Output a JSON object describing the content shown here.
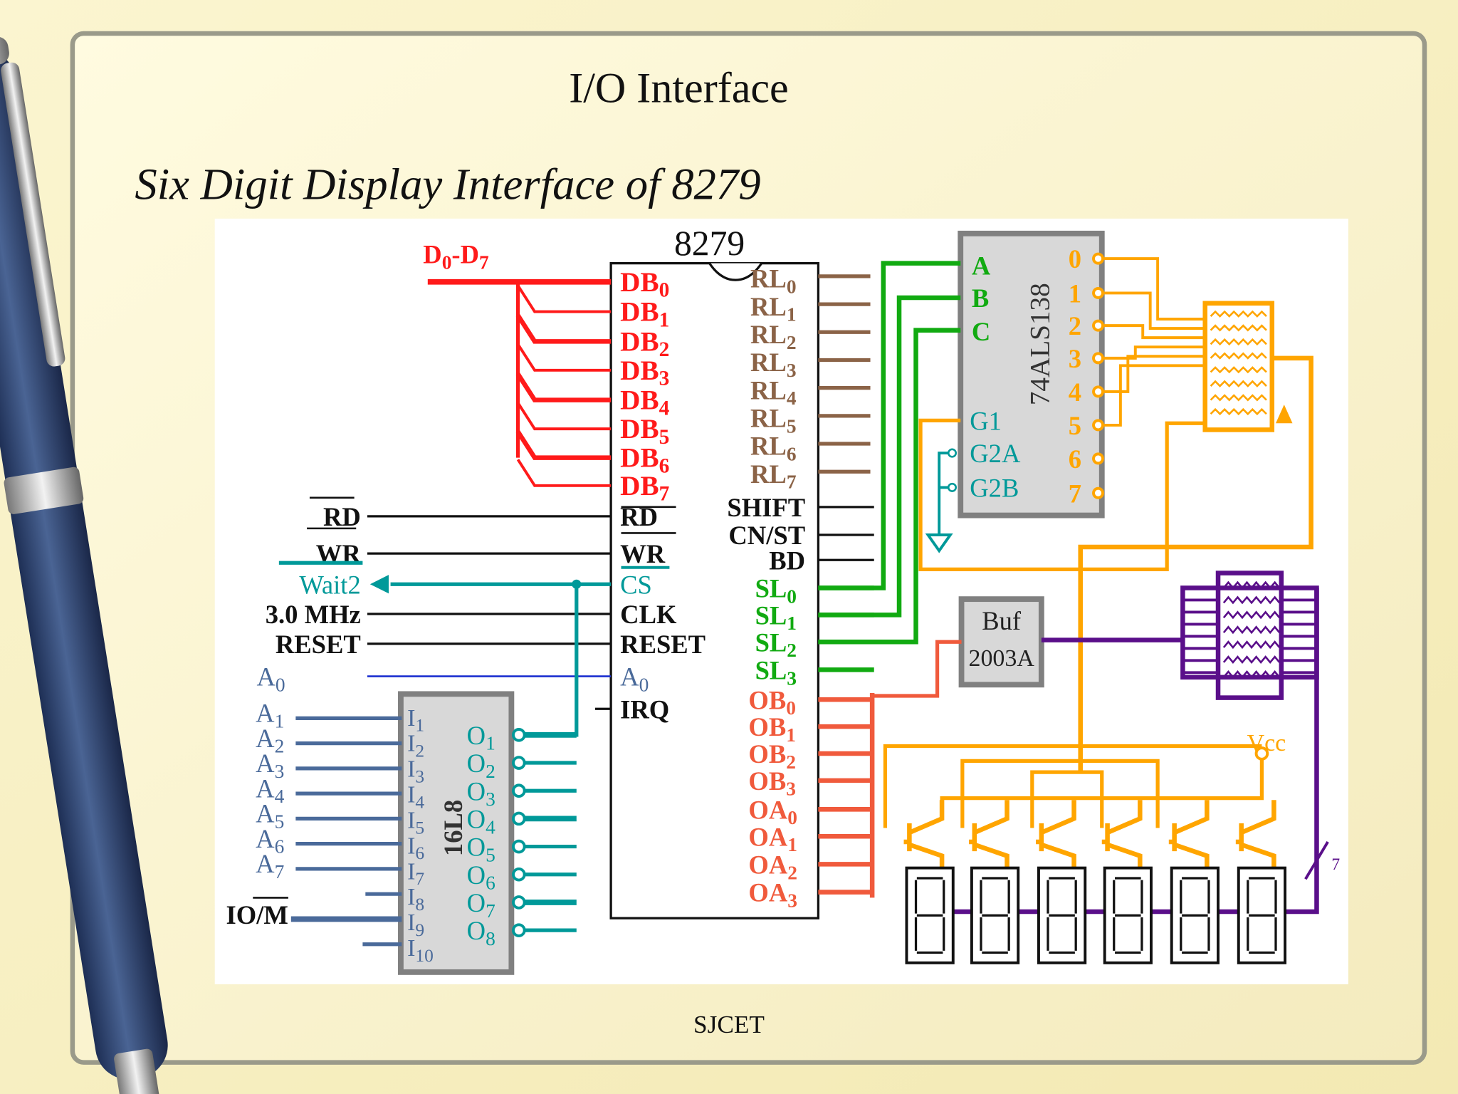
{
  "slide": {
    "title": "I/O Interface",
    "subtitle": "Six Digit Display Interface of 8279",
    "footer": "SJCET"
  },
  "colors": {
    "background": "#f7f0c4",
    "data_bus": "#ff1a1a",
    "return_lines": "#8b6347",
    "scan_lines": "#11aa11",
    "control_teal": "#009999",
    "address_blue": "#4a6a9a",
    "output_lines": "#f05a3c",
    "decoder_orange": "#ffa500",
    "segment_purple": "#5a0f8a"
  },
  "diagram": {
    "chip_8279": {
      "name": "8279",
      "bus_label": {
        "t": "D",
        "s": "0",
        "t2": "-D",
        "s2": "7"
      },
      "db_pins": [
        {
          "t": "DB",
          "s": "0"
        },
        {
          "t": "DB",
          "s": "1"
        },
        {
          "t": "DB",
          "s": "2"
        },
        {
          "t": "DB",
          "s": "3"
        },
        {
          "t": "DB",
          "s": "4"
        },
        {
          "t": "DB",
          "s": "5"
        },
        {
          "t": "DB",
          "s": "6"
        },
        {
          "t": "DB",
          "s": "7"
        }
      ],
      "rl_pins": [
        {
          "t": "RL",
          "s": "0"
        },
        {
          "t": "RL",
          "s": "1"
        },
        {
          "t": "RL",
          "s": "2"
        },
        {
          "t": "RL",
          "s": "3"
        },
        {
          "t": "RL",
          "s": "4"
        },
        {
          "t": "RL",
          "s": "5"
        },
        {
          "t": "RL",
          "s": "6"
        },
        {
          "t": "RL",
          "s": "7"
        }
      ],
      "ctrl_right": [
        "SHIFT",
        "CN/ST",
        "BD"
      ],
      "sl_pins": [
        {
          "t": "SL",
          "s": "0"
        },
        {
          "t": "SL",
          "s": "1"
        },
        {
          "t": "SL",
          "s": "2"
        },
        {
          "t": "SL",
          "s": "3"
        }
      ],
      "out_pins": [
        {
          "t": "OB",
          "s": "0"
        },
        {
          "t": "OB",
          "s": "1"
        },
        {
          "t": "OB",
          "s": "2"
        },
        {
          "t": "OB",
          "s": "3"
        },
        {
          "t": "OA",
          "s": "0"
        },
        {
          "t": "OA",
          "s": "1"
        },
        {
          "t": "OA",
          "s": "2"
        },
        {
          "t": "OA",
          "s": "3"
        }
      ],
      "left_pins": [
        {
          "t": "RD",
          "s": ""
        },
        {
          "t": "WR",
          "s": ""
        },
        {
          "t": "CS",
          "s": ""
        },
        {
          "t": "CLK",
          "s": ""
        },
        {
          "t": "RESET",
          "s": ""
        },
        {
          "t": "A",
          "s": "0"
        },
        {
          "t": "IRQ",
          "s": ""
        }
      ]
    },
    "cpu_signals": [
      {
        "t": "RD",
        "s": ""
      },
      {
        "t": "WR",
        "s": ""
      },
      {
        "t": "Wait2",
        "s": ""
      },
      {
        "t": "3.0 MHz",
        "s": ""
      },
      {
        "t": "RESET",
        "s": ""
      },
      {
        "t": "A",
        "s": "0"
      }
    ],
    "pal_16l8": {
      "name": "16L8",
      "address_inputs": [
        {
          "t": "A",
          "s": "1"
        },
        {
          "t": "A",
          "s": "2"
        },
        {
          "t": "A",
          "s": "3"
        },
        {
          "t": "A",
          "s": "4"
        },
        {
          "t": "A",
          "s": "5"
        },
        {
          "t": "A",
          "s": "6"
        },
        {
          "t": "A",
          "s": "7"
        }
      ],
      "iom_label": "IO/M",
      "inputs": [
        {
          "t": "I",
          "s": "1"
        },
        {
          "t": "I",
          "s": "2"
        },
        {
          "t": "I",
          "s": "3"
        },
        {
          "t": "I",
          "s": "4"
        },
        {
          "t": "I",
          "s": "5"
        },
        {
          "t": "I",
          "s": "6"
        },
        {
          "t": "I",
          "s": "7"
        },
        {
          "t": "I",
          "s": "8"
        },
        {
          "t": "I",
          "s": "9"
        },
        {
          "t": "I",
          "s": "10"
        }
      ],
      "outputs": [
        {
          "t": "O",
          "s": "1"
        },
        {
          "t": "O",
          "s": "2"
        },
        {
          "t": "O",
          "s": "3"
        },
        {
          "t": "O",
          "s": "4"
        },
        {
          "t": "O",
          "s": "5"
        },
        {
          "t": "O",
          "s": "6"
        },
        {
          "t": "O",
          "s": "7"
        },
        {
          "t": "O",
          "s": "8"
        }
      ]
    },
    "decoder": {
      "name": "74ALS138",
      "inputs": [
        "A",
        "B",
        "C"
      ],
      "enables": [
        "G1",
        "G2A",
        "G2B"
      ],
      "outputs": [
        "0",
        "1",
        "2",
        "3",
        "4",
        "5",
        "6",
        "7"
      ]
    },
    "buffer": {
      "line1": "Buf",
      "line2": "2003A"
    },
    "vcc_label": "Vcc",
    "bus_width_label": "7",
    "digit_count": 6
  }
}
